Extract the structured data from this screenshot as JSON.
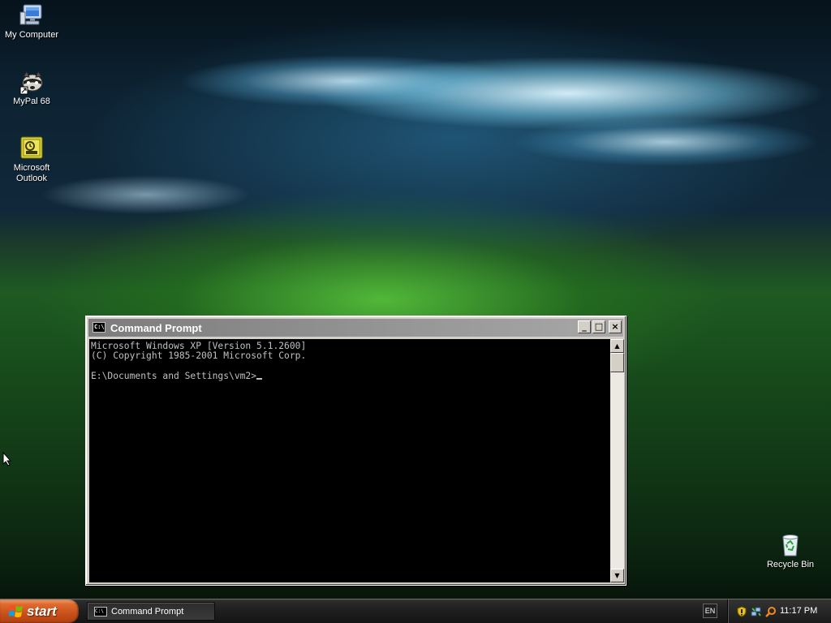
{
  "desktop": {
    "icons": [
      {
        "label": "My Computer",
        "icon": "my-computer-icon"
      },
      {
        "label": "MyPal 68",
        "icon": "mypal-browser-icon"
      },
      {
        "label_line1": "Microsoft",
        "label_line2": "Outlook",
        "icon": "outlook-icon"
      },
      {
        "label": "Recycle Bin",
        "icon": "recycle-bin-icon"
      }
    ]
  },
  "window": {
    "title": "Command Prompt",
    "icon_text": "C:\\",
    "buttons": {
      "minimize": "_",
      "maximize": "□",
      "close": "×"
    },
    "console_lines": [
      "Microsoft Windows XP [Version 5.1.2600]",
      "(C) Copyright 1985-2001 Microsoft Corp.",
      "",
      "E:\\Documents and Settings\\vm2>"
    ],
    "scroll": {
      "up": "▲",
      "down": "▼"
    }
  },
  "taskbar": {
    "start_label": "start",
    "task_label": "Command Prompt",
    "task_icon_text": "C:\\",
    "language": "EN",
    "clock": "11:17 PM",
    "tray_icons": [
      "security-shield-icon",
      "network-icon",
      "search-icon"
    ]
  },
  "colors": {
    "console_bg": "#000000",
    "console_fg": "#c0c0c0",
    "start_button": "#d0561c",
    "taskbar": "#1e1e1e"
  }
}
